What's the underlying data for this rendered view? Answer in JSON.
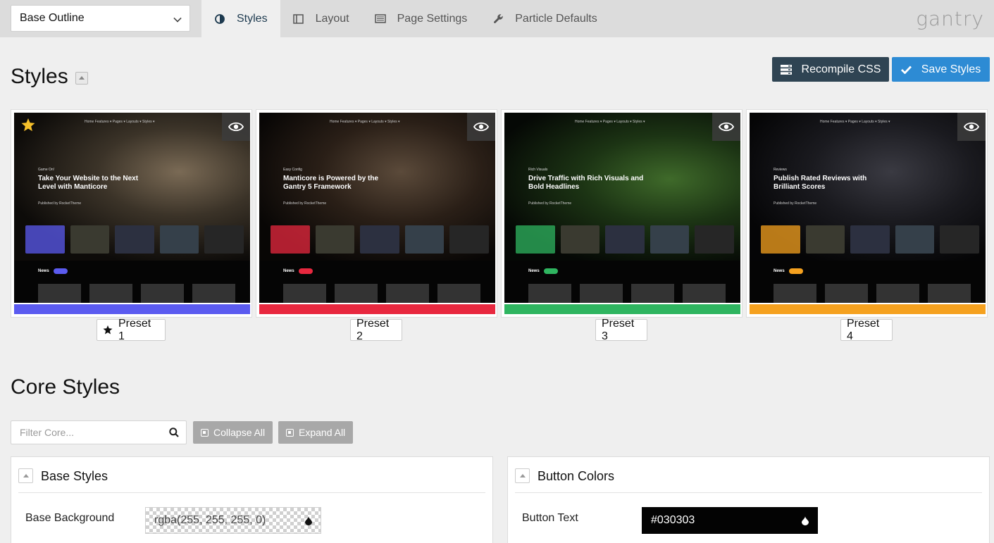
{
  "topbar": {
    "outline_select": "Base Outline",
    "tabs": [
      {
        "label": "Styles",
        "icon": "contrast-icon",
        "active": true
      },
      {
        "label": "Layout",
        "icon": "layout-icon",
        "active": false
      },
      {
        "label": "Page Settings",
        "icon": "page-settings-icon",
        "active": false
      },
      {
        "label": "Particle Defaults",
        "icon": "wrench-icon",
        "active": false
      }
    ],
    "logo": "gantry"
  },
  "styles": {
    "title": "Styles",
    "recompile_label": "Recompile CSS",
    "save_label": "Save Styles",
    "presets": [
      {
        "label": "Preset 1",
        "accent": "#5b5bf0",
        "active": true,
        "kicker": "Game On!",
        "headline": "Take Your Website to the Next Level with Manticore"
      },
      {
        "label": "Preset 2",
        "accent": "#e8283f",
        "active": false,
        "kicker": "Easy Config",
        "headline": "Manticore is Powered by the Gantry 5 Framework"
      },
      {
        "label": "Preset 3",
        "accent": "#2fb560",
        "active": false,
        "kicker": "Rich Visuals",
        "headline": "Drive Traffic with Rich Visuals and Bold Headlines"
      },
      {
        "label": "Preset 4",
        "accent": "#f5a11f",
        "active": false,
        "kicker": "Reviews",
        "headline": "Publish Rated Reviews with Brilliant Scores"
      }
    ],
    "thumb_common": {
      "nav": "Home   Features ▾   Pages ▾   Layouts ▾   Styles ▾",
      "published": "Published by RocketTheme",
      "news": "News"
    }
  },
  "core": {
    "title": "Core Styles",
    "filter_placeholder": "Filter Core...",
    "collapse_all": "Collapse All",
    "expand_all": "Expand All",
    "panels": {
      "base": {
        "title": "Base Styles",
        "field_label": "Base Background",
        "value": "rgba(255, 255, 255, 0)"
      },
      "button": {
        "title": "Button Colors",
        "field_label": "Button Text",
        "value": "#030303"
      }
    }
  }
}
